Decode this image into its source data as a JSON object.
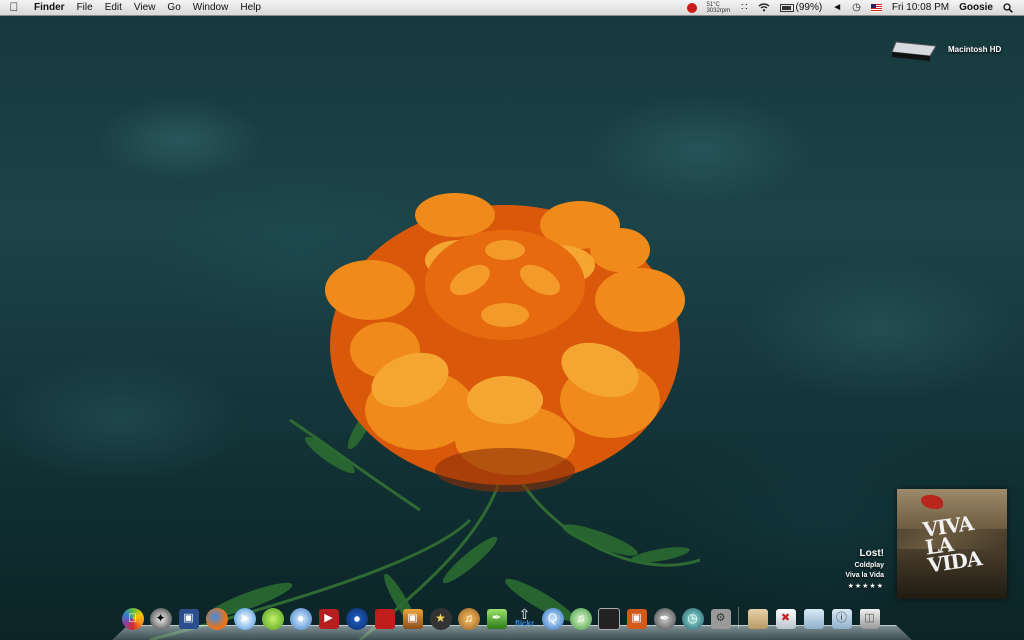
{
  "menubar": {
    "apple_icon": "apple-icon",
    "app_name": "Finder",
    "menus": [
      "File",
      "Edit",
      "View",
      "Go",
      "Window",
      "Help"
    ],
    "status": {
      "temperature": "51°C",
      "fan_speed": "3032rpm",
      "battery": "(99%)",
      "clock": "Fri 10:08 PM",
      "user": "Goosie"
    }
  },
  "desktop": {
    "drive_label": "Macintosh HD"
  },
  "now_playing": {
    "track": "Lost!",
    "artist": "Coldplay",
    "album": "Viva la Vida",
    "rating_stars": "★★★★★",
    "album_art_text": "VIVA LA VIDA"
  },
  "dock": {
    "items": [
      "apple-rainbow-icon",
      "compass-icon",
      "photo-icon",
      "firefox-icon",
      "safari-icon",
      "lime-icon",
      "chat-icon",
      "video-icon",
      "dvd-icon",
      "book-icon",
      "photo-booth-icon",
      "imovie-star-icon",
      "guitar-icon",
      "feather-icon",
      "upload-flickr-icon",
      "quicktime-icon",
      "itunes-icon",
      "preview-icon",
      "slideshow-icon",
      "pen-icon",
      "time-machine-icon",
      "settings-icon"
    ],
    "flickr_label": "flickr",
    "stacks": [
      "applications-folder-icon",
      "utilities-folder-icon",
      "documents-folder-icon",
      "info-folder-icon",
      "trash-icon"
    ]
  }
}
